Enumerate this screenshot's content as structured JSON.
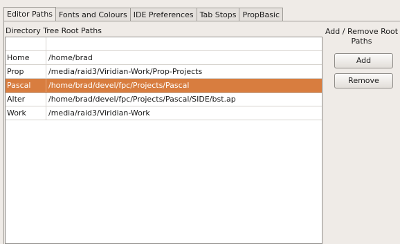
{
  "tabs": [
    {
      "label": "Editor Paths"
    },
    {
      "label": "Fonts and Colours"
    },
    {
      "label": "IDE Preferences"
    },
    {
      "label": "Tab Stops"
    },
    {
      "label": "PropBasic"
    }
  ],
  "list": {
    "title": "Directory Tree Root Paths",
    "rows": [
      {
        "name": "",
        "path": ""
      },
      {
        "name": "Home",
        "path": "/home/brad"
      },
      {
        "name": "Prop",
        "path": "/media/raid3/Viridian-Work/Prop-Projects"
      },
      {
        "name": "Pascal",
        "path": "/home/brad/devel/fpc/Projects/Pascal"
      },
      {
        "name": "Alter",
        "path": "/home/brad/devel/fpc/Projects/Pascal/SIDE/bst.ap"
      },
      {
        "name": "Work",
        "path": "/media/raid3/Viridian-Work"
      }
    ],
    "selected_row": "Pascal"
  },
  "side": {
    "title": "Add / Remove Root Paths",
    "add_label": "Add",
    "remove_label": "Remove"
  },
  "colors": {
    "selection": "#d87d3f",
    "background": "#efebe7"
  }
}
